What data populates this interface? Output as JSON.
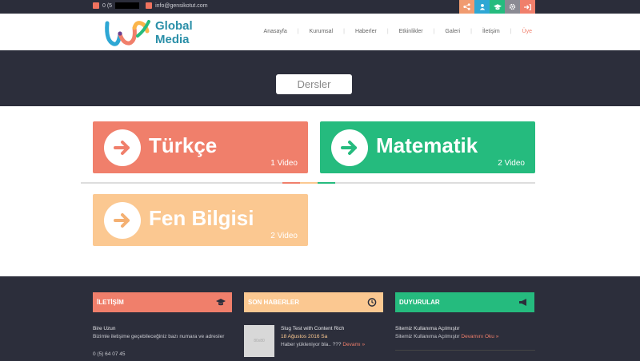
{
  "topbar": {
    "phone": "0 (5",
    "email": "info@gensikotut.com",
    "social_icons": [
      "share-icon",
      "user-icon",
      "graduation-cap-icon",
      "settings-icon",
      "logout-icon"
    ],
    "social_colors": [
      "#f09b70",
      "#2ea7d4",
      "#25bb7e",
      "#8a8a93",
      "#f07f6b"
    ]
  },
  "header": {
    "logo_line1": "Global",
    "logo_line2": "Media",
    "nav": [
      "Anasayfa",
      "Kurumsal",
      "Haberler",
      "Etkinlikler",
      "Galeri",
      "İletişim",
      "Üye"
    ]
  },
  "hero": {
    "title": "Dersler"
  },
  "courses": [
    {
      "name": "Türkçe",
      "count": "1 Video",
      "color": "#f07f6b"
    },
    {
      "name": "Matematik",
      "count": "2 Video",
      "color": "#25bb7e"
    },
    {
      "name": "Fen Bilgisi",
      "count": "2 Video",
      "color": "#fbc891"
    }
  ],
  "footer": {
    "contact": {
      "heading": "İLETİŞİM",
      "name": "Bire Uzun",
      "desc": "Bizimle iletişime geçebileceğiniz bazı numara ve adresler",
      "phone": "0 (5) 64 07 45"
    },
    "news": {
      "heading": "SON HABERLER",
      "thumb": "80x80",
      "title": "Slug Test with Content Rich",
      "date": "18 Ağustos 2016 Sa",
      "excerpt": "Haber yükleniyor bla.. ???",
      "more": "Devamı »"
    },
    "announcements": {
      "heading": "DUYURULAR",
      "title": "Sitemiz Kullanıma Açılmıştır",
      "text": "Sitemiz Kullanıma Açılmıştır",
      "more": "Devamını Oku »"
    }
  }
}
